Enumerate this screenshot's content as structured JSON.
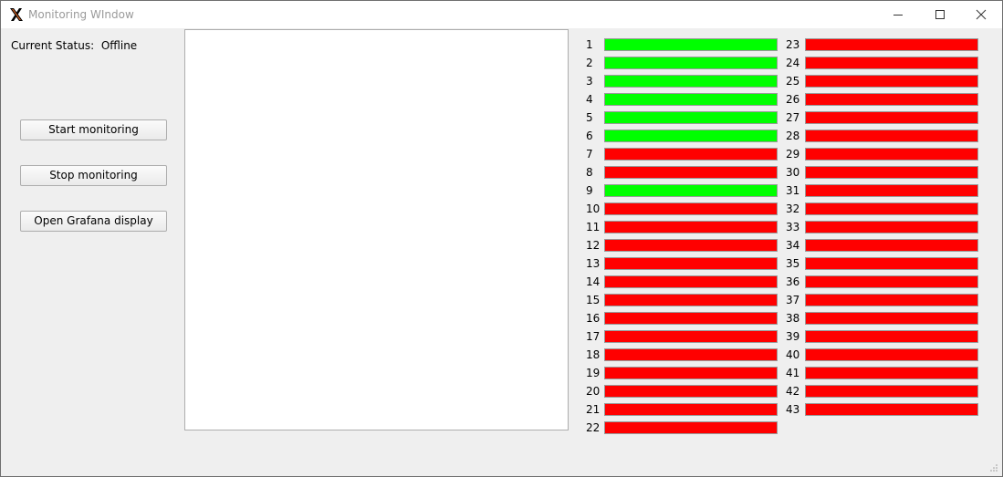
{
  "window": {
    "title": "Monitoring WIndow",
    "controls": [
      "minimize-icon",
      "maximize-icon",
      "close-icon"
    ]
  },
  "status": {
    "label": "Current Status:",
    "value": "Offline"
  },
  "buttons": {
    "start": "Start monitoring",
    "stop": "Stop monitoring",
    "grafana": "Open Grafana display"
  },
  "colors": {
    "online": "#00ff00",
    "offline": "#ff0000"
  },
  "channels": [
    {
      "id": "1",
      "state": "online"
    },
    {
      "id": "2",
      "state": "online"
    },
    {
      "id": "3",
      "state": "online"
    },
    {
      "id": "4",
      "state": "online"
    },
    {
      "id": "5",
      "state": "online"
    },
    {
      "id": "6",
      "state": "online"
    },
    {
      "id": "7",
      "state": "offline"
    },
    {
      "id": "8",
      "state": "offline"
    },
    {
      "id": "9",
      "state": "online"
    },
    {
      "id": "10",
      "state": "offline"
    },
    {
      "id": "11",
      "state": "offline"
    },
    {
      "id": "12",
      "state": "offline"
    },
    {
      "id": "13",
      "state": "offline"
    },
    {
      "id": "14",
      "state": "offline"
    },
    {
      "id": "15",
      "state": "offline"
    },
    {
      "id": "16",
      "state": "offline"
    },
    {
      "id": "17",
      "state": "offline"
    },
    {
      "id": "18",
      "state": "offline"
    },
    {
      "id": "19",
      "state": "offline"
    },
    {
      "id": "20",
      "state": "offline"
    },
    {
      "id": "21",
      "state": "offline"
    },
    {
      "id": "22",
      "state": "offline"
    },
    {
      "id": "23",
      "state": "offline"
    },
    {
      "id": "24",
      "state": "offline"
    },
    {
      "id": "25",
      "state": "offline"
    },
    {
      "id": "26",
      "state": "offline"
    },
    {
      "id": "27",
      "state": "offline"
    },
    {
      "id": "28",
      "state": "offline"
    },
    {
      "id": "29",
      "state": "offline"
    },
    {
      "id": "30",
      "state": "offline"
    },
    {
      "id": "31",
      "state": "offline"
    },
    {
      "id": "32",
      "state": "offline"
    },
    {
      "id": "33",
      "state": "offline"
    },
    {
      "id": "34",
      "state": "offline"
    },
    {
      "id": "35",
      "state": "offline"
    },
    {
      "id": "36",
      "state": "offline"
    },
    {
      "id": "37",
      "state": "offline"
    },
    {
      "id": "38",
      "state": "offline"
    },
    {
      "id": "39",
      "state": "offline"
    },
    {
      "id": "40",
      "state": "offline"
    },
    {
      "id": "41",
      "state": "offline"
    },
    {
      "id": "42",
      "state": "offline"
    },
    {
      "id": "43",
      "state": "offline"
    }
  ]
}
